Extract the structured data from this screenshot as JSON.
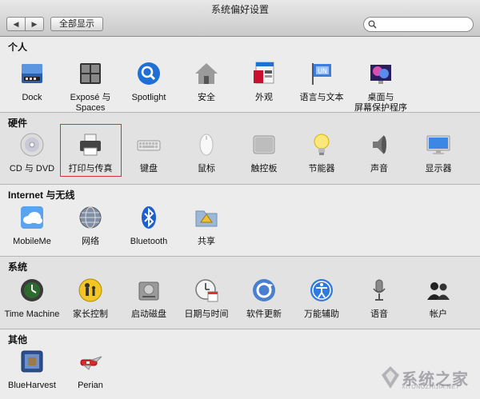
{
  "window": {
    "title": "系统偏好设置"
  },
  "toolbar": {
    "back_label": "◀",
    "forward_label": "▶",
    "show_all_label": "全部显示"
  },
  "search": {
    "value": "",
    "placeholder": ""
  },
  "sections": [
    {
      "title": "个人",
      "items": [
        {
          "label": "Dock",
          "icon": "dock-icon"
        },
        {
          "label": "Exposé 与",
          "label2": "Spaces",
          "icon": "expose-spaces-icon"
        },
        {
          "label": "Spotlight",
          "icon": "spotlight-icon"
        },
        {
          "label": "安全",
          "icon": "security-house-icon"
        },
        {
          "label": "外观",
          "icon": "appearance-icon"
        },
        {
          "label": "语言与文本",
          "icon": "language-flag-icon"
        },
        {
          "label": "桌面与",
          "label2": "屏幕保护程序",
          "icon": "desktop-screensaver-icon"
        }
      ]
    },
    {
      "title": "硬件",
      "items": [
        {
          "label": "CD 与 DVD",
          "icon": "cd-dvd-icon"
        },
        {
          "label": "打印与传真",
          "icon": "printer-icon"
        },
        {
          "label": "键盘",
          "icon": "keyboard-icon"
        },
        {
          "label": "鼠标",
          "icon": "mouse-icon"
        },
        {
          "label": "触控板",
          "icon": "trackpad-icon"
        },
        {
          "label": "节能器",
          "icon": "bulb-icon"
        },
        {
          "label": "声音",
          "icon": "speaker-icon"
        },
        {
          "label": "显示器",
          "icon": "display-icon"
        }
      ]
    },
    {
      "title": "Internet 与无线",
      "items": [
        {
          "label": "MobileMe",
          "icon": "cloud-icon"
        },
        {
          "label": "网络",
          "icon": "network-globe-icon"
        },
        {
          "label": "Bluetooth",
          "icon": "bluetooth-icon"
        },
        {
          "label": "共享",
          "icon": "sharing-folder-icon"
        }
      ]
    },
    {
      "title": "系统",
      "items": [
        {
          "label": "Time Machine",
          "icon": "time-machine-icon"
        },
        {
          "label": "家长控制",
          "icon": "parental-controls-icon"
        },
        {
          "label": "启动磁盘",
          "icon": "startup-disk-icon"
        },
        {
          "label": "日期与时间",
          "icon": "date-time-icon"
        },
        {
          "label": "软件更新",
          "icon": "software-update-icon"
        },
        {
          "label": "万能辅助",
          "icon": "universal-access-icon"
        },
        {
          "label": "语音",
          "icon": "microphone-icon"
        },
        {
          "label": "帐户",
          "icon": "accounts-icon"
        }
      ]
    },
    {
      "title": "其他",
      "items": [
        {
          "label": "BlueHarvest",
          "icon": "blueharvest-icon"
        },
        {
          "label": "Perian",
          "icon": "perian-knife-icon"
        }
      ]
    }
  ],
  "watermark": {
    "text": "系统之家",
    "url": "XITONGZHIJIA.NET"
  }
}
